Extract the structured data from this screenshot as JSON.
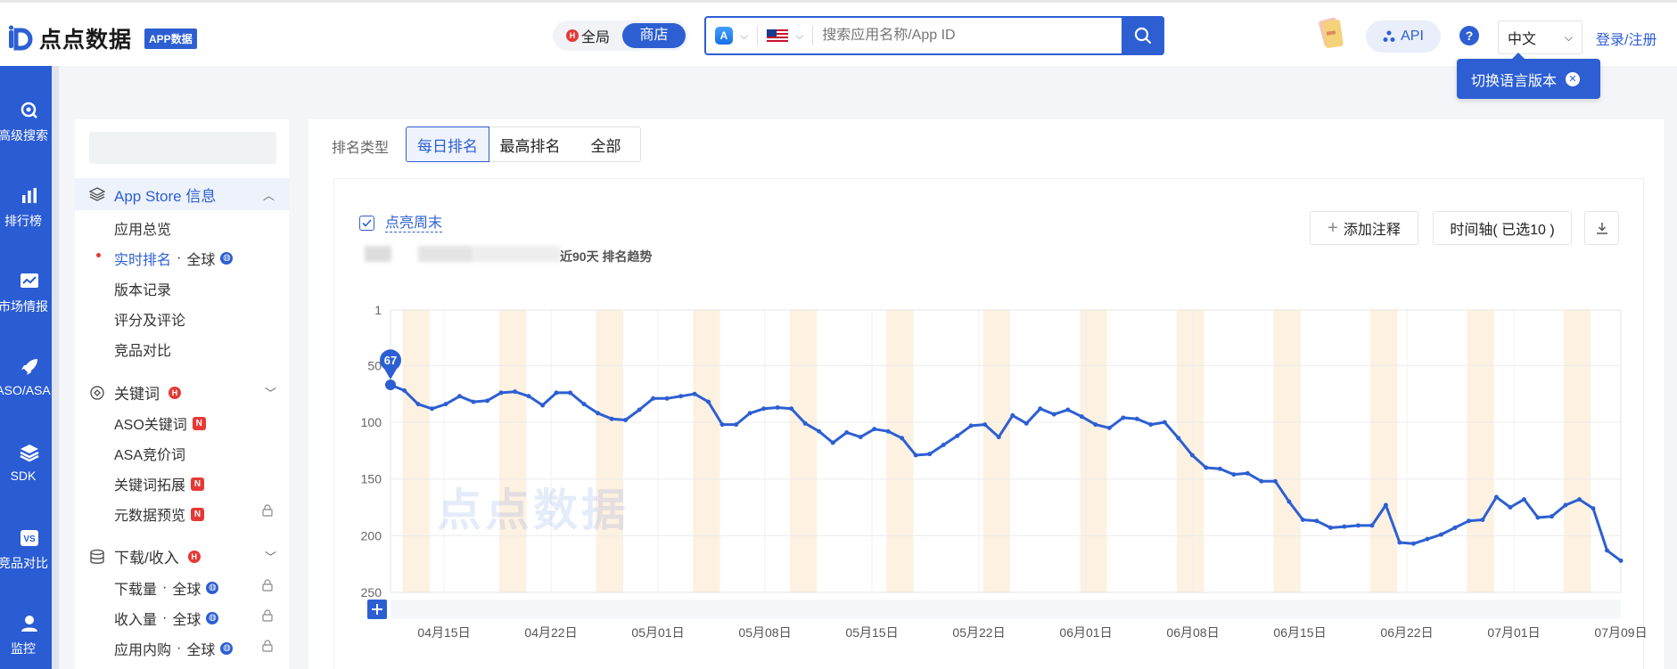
{
  "header": {
    "logo_text": "点点数据",
    "logo_badge": "APP数据",
    "scope_global": "全局",
    "scope_h_badge": "H",
    "scope_store": "商店",
    "search_placeholder": "搜索应用名称/App ID",
    "api_label": "API",
    "help_label": "?",
    "language": "中文",
    "login_label": "登录/注册",
    "lang_tip": "切换语言版本"
  },
  "leftnav": [
    {
      "label": "高级搜索",
      "icon": "search-icon"
    },
    {
      "label": "排行榜",
      "icon": "bar-chart-icon"
    },
    {
      "label": "市场情报",
      "icon": "market-icon"
    },
    {
      "label": "ASO/ASA",
      "icon": "rocket-icon"
    },
    {
      "label": "SDK",
      "icon": "layers-icon"
    },
    {
      "label": "竞品对比",
      "icon": "vs-icon"
    },
    {
      "label": "监控",
      "icon": "user-monitor-icon"
    }
  ],
  "sidemenu": {
    "group_appstore": "App Store 信息",
    "appstore_items": [
      "应用总览",
      "实时排名",
      "版本记录",
      "评分及评论",
      "竞品对比"
    ],
    "realtime_suffix": "全球",
    "group_keyword": "关键词",
    "keyword_items": [
      "ASO关键词",
      "ASA竞价词",
      "关键词拓展",
      "元数据预览"
    ],
    "group_download": "下载/收入",
    "download_items": [
      "下载量",
      "收入量",
      "应用内购"
    ],
    "global_suffix": "全球",
    "badge_h": "H",
    "badge_n": "N"
  },
  "main": {
    "rank_type_label": "排名类型",
    "segments": [
      "每日排名",
      "最高排名",
      "全部"
    ],
    "weekend_label": "点亮周末",
    "subtitle": "近90天 排名趋势",
    "add_note": "添加注释",
    "timeline": "时间轴( 已选10 )",
    "watermark": "点点数据"
  },
  "chart_data": {
    "type": "line",
    "title": "近90天 排名趋势",
    "y_reversed": true,
    "ylim": [
      1,
      250
    ],
    "y_ticks": [
      1,
      50,
      100,
      150,
      200,
      250
    ],
    "x_ticks": [
      "04月15日",
      "04月22日",
      "05月01日",
      "05月08日",
      "05月15日",
      "05月22日",
      "06月01日",
      "06月08日",
      "06月15日",
      "06月22日",
      "07月01日",
      "07月09日"
    ],
    "weekend_highlight": true,
    "marker_label": "67",
    "series": [
      {
        "values": [
          67,
          72,
          84,
          88,
          84,
          77,
          82,
          81,
          74,
          73,
          77,
          85,
          74,
          74,
          84,
          92,
          97,
          98,
          89,
          79,
          79,
          77,
          75,
          82,
          102,
          102,
          92,
          88,
          87,
          88,
          101,
          108,
          118,
          109,
          113,
          106,
          108,
          114,
          129,
          128,
          120,
          112,
          103,
          102,
          113,
          94,
          101,
          88,
          93,
          89,
          95,
          102,
          105,
          96,
          97,
          102,
          100,
          114,
          129,
          140,
          141,
          146,
          145,
          152,
          152,
          170,
          186,
          187,
          193,
          192,
          191,
          191,
          173,
          206,
          207,
          203,
          199,
          193,
          187,
          186,
          166,
          175,
          168,
          184,
          183,
          173,
          168,
          176,
          213,
          222
        ]
      }
    ]
  }
}
